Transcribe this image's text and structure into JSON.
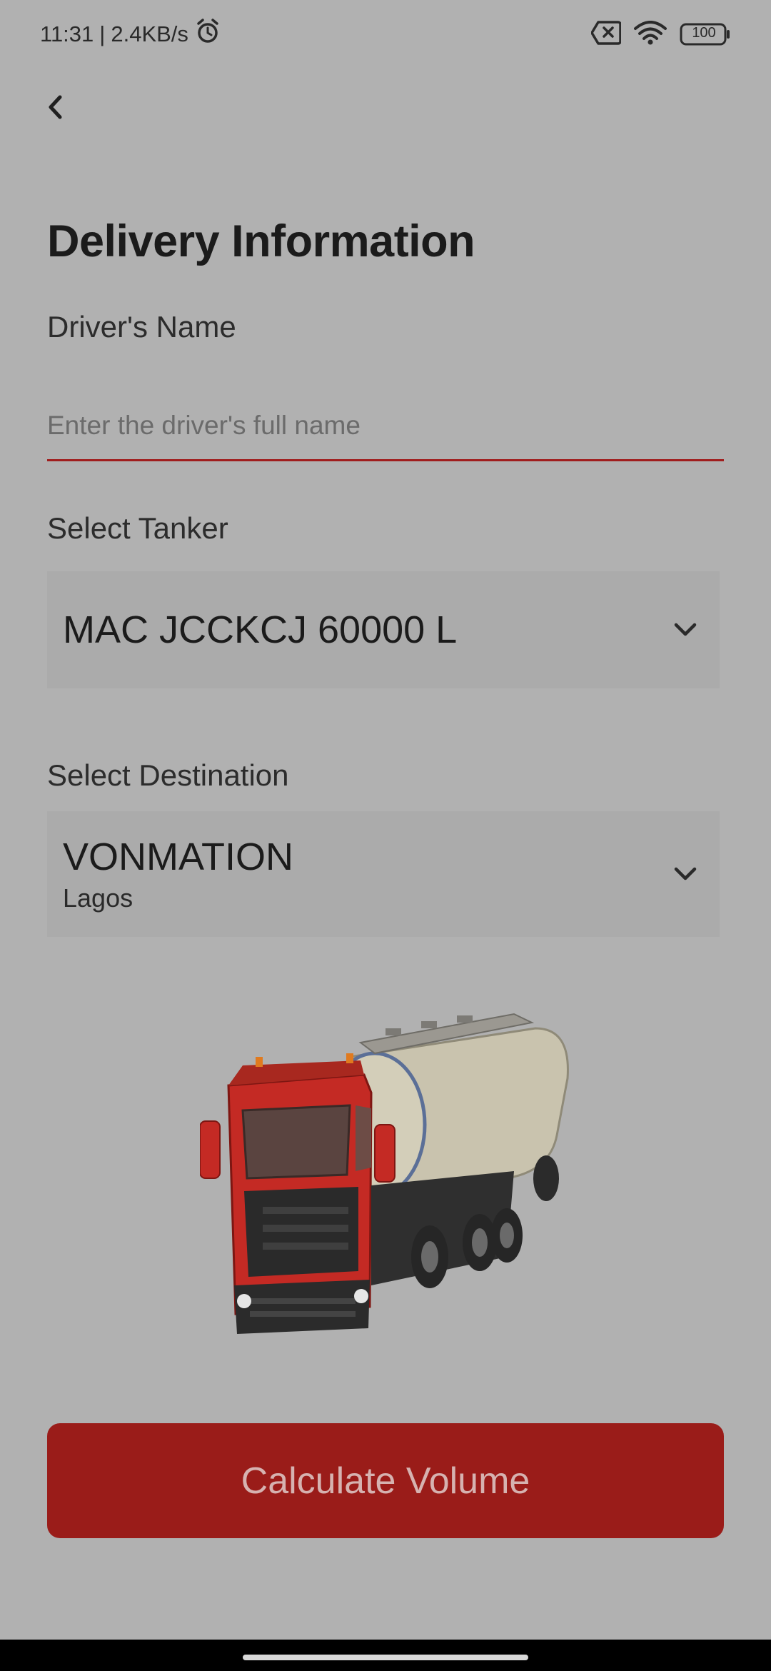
{
  "status_bar": {
    "time": "11:31",
    "separator": "|",
    "speed": "2.4KB/s",
    "battery": "100"
  },
  "page": {
    "title": "Delivery Information"
  },
  "driver": {
    "label": "Driver's Name",
    "placeholder": "Enter the driver's full name",
    "value": ""
  },
  "tanker": {
    "label": "Select Tanker",
    "selected": "MAC JCCKCJ 60000 L"
  },
  "destination": {
    "label": "Select Destination",
    "selected": "VONMATION",
    "sub": "Lagos"
  },
  "actions": {
    "calculate_label": "Calculate Volume"
  },
  "colors": {
    "background": "#b1b1b1",
    "accent": "#9a1c19",
    "underline": "#a01d1d"
  },
  "icons": {
    "back": "chevron-left-icon",
    "dropdown": "chevron-down-icon",
    "alarm": "alarm-icon",
    "sim": "sim-error-icon",
    "wifi": "wifi-icon",
    "battery": "battery-icon"
  }
}
